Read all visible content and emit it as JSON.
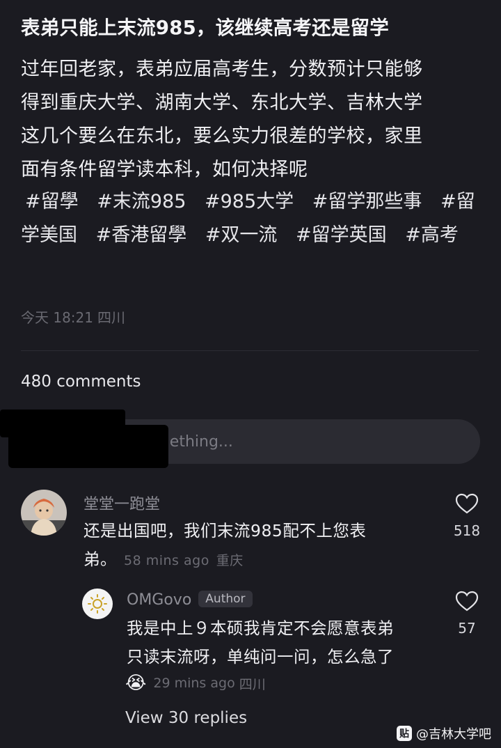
{
  "post": {
    "title": "表弟只能上末流985，该继续高考还是留学",
    "body_lines": [
      "过年回老家，表弟应届高考生，分数预计只能够",
      "得到重庆大学、湖南大学、东北大学、吉林大学",
      "这几个要么在东北，要么实力很差的学校，家里",
      "面有条件留学读本科，如何决择呢"
    ],
    "tags": [
      "#留學",
      "#末流985",
      "#985大学",
      "#留学那些事",
      "#留学美国",
      "#香港留學",
      "#双一流",
      "#留学英国",
      "#高考"
    ],
    "date": "今天 18:21",
    "location": "四川"
  },
  "comments_header": {
    "count_label": "480 comments"
  },
  "input": {
    "placeholder": "Say something..."
  },
  "comment1": {
    "username": "堂堂一跑堂",
    "text_line1": "还是出国吧，我们末流985配不上您表",
    "text_line2": "弟。",
    "time": "58 mins ago",
    "location": "重庆",
    "likes": "518"
  },
  "reply1": {
    "username": "OMGovo",
    "badge": "Author",
    "text_line1": "我是中上９本硕我肯定不会愿意表弟",
    "text_line2": "只读末流呀，单纯问一问，怎么急了",
    "emoji": "😭",
    "time": "29 mins ago",
    "location": "四川",
    "likes": "57"
  },
  "view_replies": "View 30 replies",
  "watermark": {
    "logo": "贴",
    "text": "@吉林大学吧"
  },
  "colors": {
    "background": "#1b1b21",
    "text": "#f2f2f5",
    "muted": "#6c6c74"
  },
  "icons": [
    "heart-icon",
    "sun-avatar-icon",
    "crying-emoji"
  ]
}
